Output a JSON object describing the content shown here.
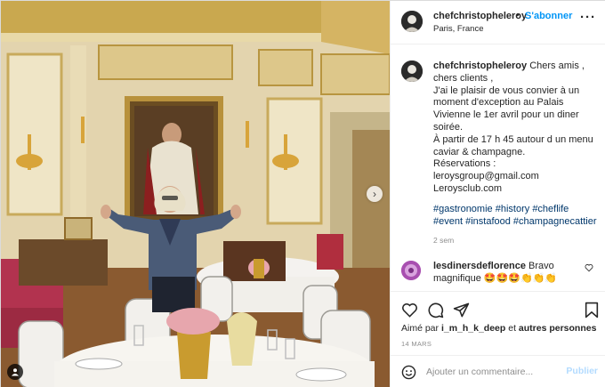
{
  "header": {
    "username": "chefchristopheleroy",
    "separator": "•",
    "follow_label": "S'abonner",
    "location": "Paris, France",
    "more_icon": "more-horizontal-icon"
  },
  "caption": {
    "username": "chefchristopheleroy",
    "lines": [
      " Chers amis ,",
      "chers clients ,",
      "J'ai le plaisir de vous convier à un",
      "moment d'exception au Palais",
      "Vivienne le 1er avril pour un diner",
      "soirée.",
      "À partir de 17 h 45 autour d un menu",
      "caviar & champagne.",
      "Réservations :",
      "leroysgroup@gmail.com",
      "Leroysclub.com"
    ],
    "hashtags": [
      "#gastronomie",
      "#history",
      "#cheflife",
      "#event",
      "#instafood",
      "#champagnecattier"
    ],
    "time_ago": "2 sem"
  },
  "comment": {
    "username": "lesdinersdeflorence",
    "text": " Bravo magnifique 🤩🤩🤩👏👏👏"
  },
  "actions": {
    "like_icon": "heart-icon",
    "comment_icon": "comment-icon",
    "share_icon": "paper-plane-icon",
    "save_icon": "bookmark-icon"
  },
  "likes": {
    "prefix": "Aimé par ",
    "user": "i_m_h_k_deep",
    "middle": " et ",
    "others": "autres personnes"
  },
  "date": "14 MARS",
  "add_comment": {
    "placeholder": "Ajouter un commentaire...",
    "post_label": "Publier",
    "emoji_icon": "smiley-icon"
  },
  "colors": {
    "link_blue": "#0095f6",
    "hashtag_blue": "#00376b",
    "muted_gray": "#8e8e8e",
    "post_disabled": "#b3dbff"
  }
}
